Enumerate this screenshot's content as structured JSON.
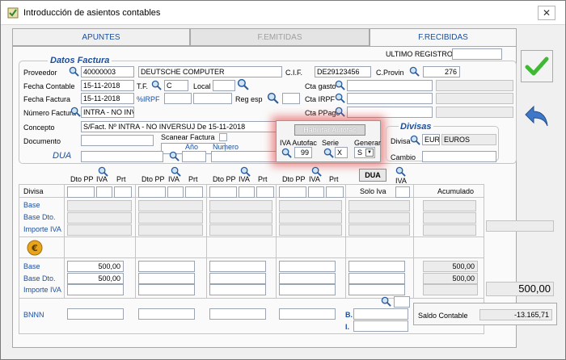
{
  "window": {
    "title": "Introducción de asientos contables",
    "close": "✕"
  },
  "tabs": [
    {
      "label": "APUNTES",
      "state": "normal"
    },
    {
      "label": "F.EMITIDAS",
      "state": "disabled"
    },
    {
      "label": "F.RECIBIDAS",
      "state": "active"
    }
  ],
  "header": {
    "ultimo_registro_label": "ULTIMO REGISTRO",
    "ultimo_registro_value": ""
  },
  "datos_factura": {
    "title": "Datos Factura",
    "proveedor_label": "Proveedor",
    "proveedor_code": "40000003",
    "proveedor_name": "DEUTSCHE COMPUTER",
    "cif_label": "C.I.F.",
    "cif_value": "DE29123456",
    "cprovin_label": "C.Provin",
    "cprovin_value": "276",
    "fecha_contable_label": "Fecha Contable",
    "fecha_contable_value": "15-11-2018",
    "tf_label": "T.F.",
    "tf_value": "C",
    "local_label": "Local",
    "cta_gasto_label": "Cta gasto",
    "fecha_factura_label": "Fecha Factura",
    "fecha_factura_value": "15-11-2018",
    "irpf_label": "%IRPF",
    "reg_esp_label": "Reg esp",
    "cta_irpf_label": "Cta  IRPF",
    "numero_factura_label": "Número Factura",
    "numero_factura_value": "INTRA - NO INV",
    "cta_ppago_label": "Cta PPago",
    "concepto_label": "Concepto",
    "concepto_value": "S/Fact. Nº INTRA - NO INVERSUJ De 15-11-2018",
    "documento_label": "Documento",
    "scanear_label": "Scanear Factura",
    "dua_label": "DUA",
    "anio_label": "Año",
    "numero_label": "Numero"
  },
  "autofac_dialog": {
    "button_label": "Habilitar Autofac",
    "iva_autofac_label": "IVA Autofac",
    "serie_label": "Serie",
    "generar_label": "Generar",
    "iva_autofac_value": "99",
    "serie_value": "X",
    "generar_value": "S"
  },
  "divisas": {
    "title": "Divisas",
    "divisa_label": "Divisa",
    "divisa_code": "EUR",
    "divisa_name": "EUROS",
    "cambio_label": "Cambio"
  },
  "grid": {
    "dua_button": "DUA",
    "iva_label": "IVA",
    "col_dto_pp": "Dto PP",
    "col_iva": "IVA",
    "col_prt": "Prt",
    "col_divisa": "Divisa",
    "col_solo_iva": "Solo Iva",
    "col_acumulado": "Acumulado",
    "row_base": "Base",
    "row_base_dto": "Base Dto.",
    "row_importe_iva": "Importe IVA",
    "euro_base_value": "500,00",
    "euro_base_dto_value": "500,00",
    "acum_base_value": "500,00",
    "acum_base_dto_value": "500,00",
    "bnnn_label": "BNNN",
    "b_label": "B.",
    "i_label": "I.",
    "euro_symbol": "€"
  },
  "totals": {
    "total_value": "500,00",
    "saldo_contable_label": "Saldo Contable",
    "saldo_contable_value": "-13.165,71"
  },
  "icons": {
    "accept": "check-icon",
    "back": "back-arrow-icon",
    "search": "magnifier-icon",
    "euro": "euro-coin-icon"
  },
  "colors": {
    "accent_blue": "#1a4fa0",
    "check_green": "#3fb934",
    "back_blue": "#3f78c8",
    "euro_gold": "#e7a51c"
  }
}
